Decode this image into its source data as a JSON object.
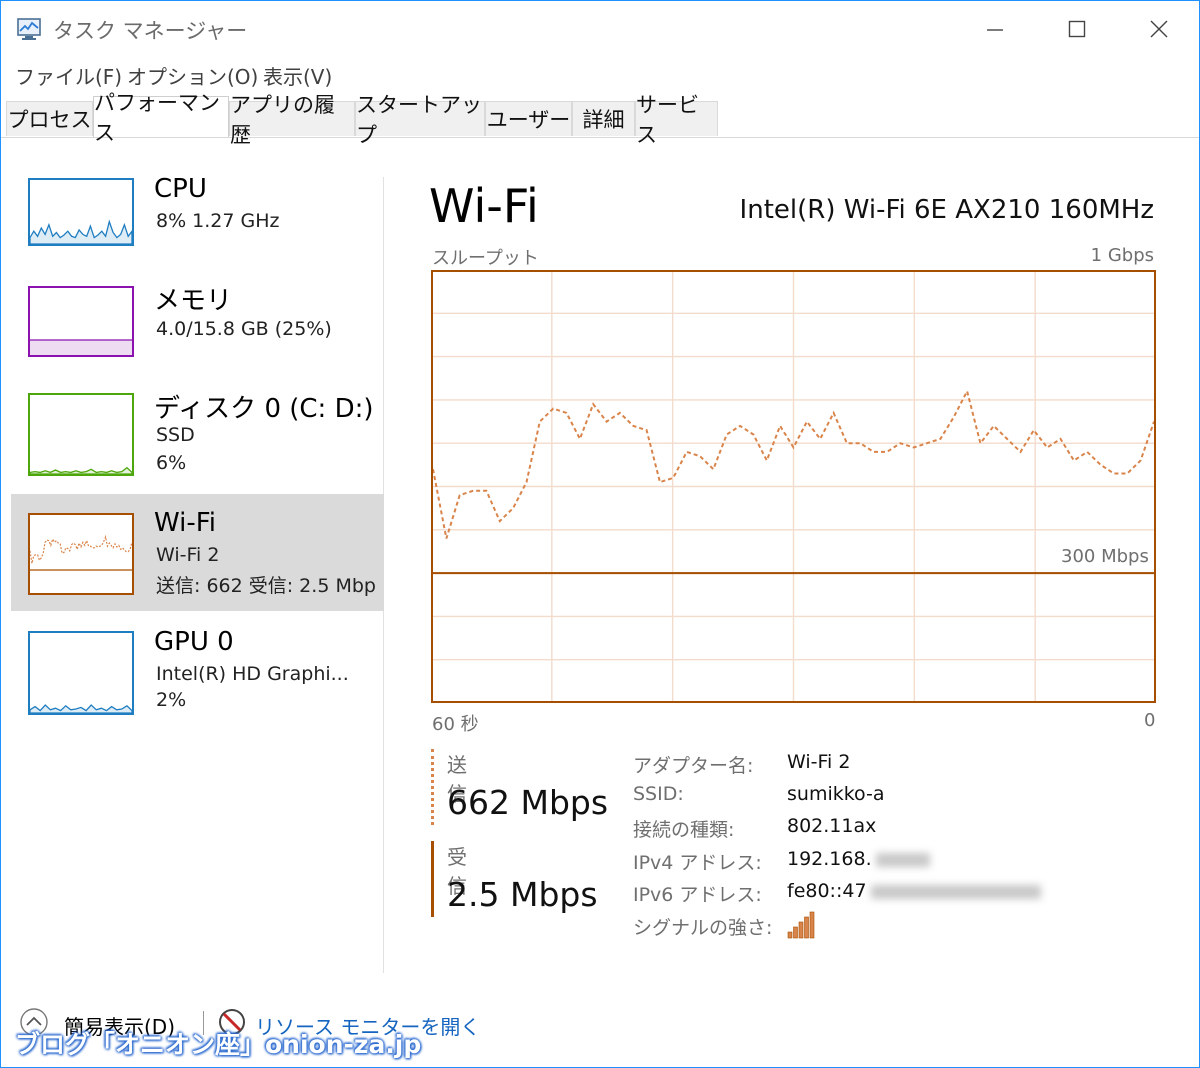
{
  "window": {
    "title": "タスク マネージャー",
    "border_color": "#1e90ff"
  },
  "menu": [
    "ファイル(F)",
    "オプション(O)",
    "表示(V)"
  ],
  "tabs": [
    {
      "label": "プロセス",
      "active": false
    },
    {
      "label": "パフォーマンス",
      "active": true
    },
    {
      "label": "アプリの履歴",
      "active": false
    },
    {
      "label": "スタートアップ",
      "active": false
    },
    {
      "label": "ユーザー",
      "active": false
    },
    {
      "label": "詳細",
      "active": false
    },
    {
      "label": "サービス",
      "active": false
    }
  ],
  "sidebar": {
    "items": [
      {
        "name": "CPU",
        "line1": "8%  1.27 GHz",
        "line2": "",
        "color": "#1f7ec1",
        "selected": false,
        "icon": "cpu-graph"
      },
      {
        "name": "メモリ",
        "line1": "4.0/15.8 GB (25%)",
        "line2": "",
        "color": "#8b12ae",
        "selected": false,
        "icon": "memory-graph"
      },
      {
        "name": "ディスク 0 (C: D:)",
        "line1": "SSD",
        "line2": "6%",
        "color": "#4da60c",
        "selected": false,
        "icon": "disk-graph"
      },
      {
        "name": "Wi-Fi",
        "line1": "Wi-Fi 2",
        "line2": "送信: 662  受信: 2.5 Mbp",
        "color": "#a74f01",
        "selected": true,
        "icon": "wifi-graph"
      },
      {
        "name": "GPU 0",
        "line1": "Intel(R) HD Graphi...",
        "line2": "2%",
        "color": "#1f7ec1",
        "selected": false,
        "icon": "gpu-graph"
      }
    ]
  },
  "main": {
    "title": "Wi-Fi",
    "adapter_model": "Intel(R) Wi-Fi 6E AX210 160MHz",
    "throughput_label": "スループット",
    "max_label": "1 Gbps",
    "scale_label": "300 Mbps",
    "time_left": "60 秒",
    "time_right": "0",
    "send": {
      "label": "送信",
      "value": "662 Mbps"
    },
    "receive": {
      "label": "受信",
      "value": "2.5 Mbps"
    },
    "properties": [
      {
        "label": "アダプター名:",
        "value": "Wi-Fi 2"
      },
      {
        "label": "SSID:",
        "value": "sumikko-a"
      },
      {
        "label": "接続の種類:",
        "value": "802.11ax"
      },
      {
        "label": "IPv4 アドレス:",
        "value": "192.168."
      },
      {
        "label": "IPv6 アドレス:",
        "value": "fe80::47"
      },
      {
        "label": "シグナルの強さ:",
        "value": ""
      }
    ],
    "signal_bars": 5,
    "colors": {
      "accent": "#a74f01",
      "grid": "#f3dccb",
      "send_line": "#d9844a"
    }
  },
  "chart_data": {
    "type": "line",
    "x_label": "60 秒",
    "x_range": [
      60,
      0
    ],
    "y_range_mbps": [
      0,
      1000
    ],
    "y_max_label": "1 Gbps",
    "scale_line_mbps": 300,
    "grid": true,
    "series": [
      {
        "name": "送信",
        "style": "dashed",
        "values": [
          540,
          380,
          480,
          490,
          490,
          420,
          450,
          510,
          650,
          680,
          670,
          610,
          690,
          650,
          670,
          640,
          630,
          510,
          520,
          580,
          570,
          540,
          620,
          640,
          620,
          560,
          640,
          590,
          650,
          610,
          670,
          600,
          600,
          580,
          580,
          600,
          590,
          600,
          610,
          660,
          720,
          600,
          640,
          610,
          580,
          630,
          590,
          610,
          560,
          580,
          550,
          530,
          530,
          560,
          650
        ]
      },
      {
        "name": "受信",
        "style": "solid",
        "values": [
          300,
          300,
          300,
          300,
          300,
          300,
          300,
          300,
          300,
          300,
          300,
          300,
          300,
          300,
          300,
          300,
          300,
          300,
          300,
          300,
          300,
          300,
          300,
          300,
          300,
          300,
          300,
          300,
          300,
          300,
          300,
          300,
          300,
          300,
          300,
          300,
          300,
          300,
          300,
          300,
          300,
          300,
          300,
          300,
          300,
          300,
          300,
          300,
          300,
          300,
          300,
          300,
          300,
          300,
          300
        ]
      }
    ]
  },
  "footer": {
    "fewer_details": "簡易表示(D)",
    "resource_monitor": "リソース モニターを開く",
    "watermark": "ブログ「オニオン座」onion-za.jp"
  }
}
